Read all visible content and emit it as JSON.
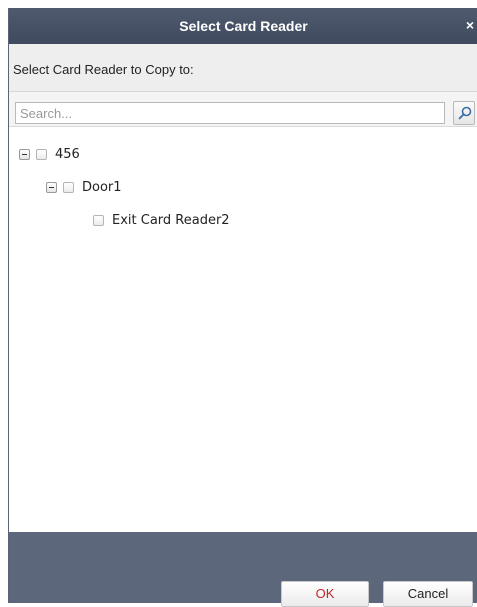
{
  "dialog": {
    "title": "Select Card Reader",
    "close_label": "×",
    "subheader": "Select Card Reader to Copy to:"
  },
  "search": {
    "placeholder": "Search...",
    "icon": "search-icon"
  },
  "tree": {
    "nodes": [
      {
        "label": "456",
        "expanded": true,
        "checked": false,
        "level": 0
      },
      {
        "label": "Door1",
        "expanded": true,
        "checked": false,
        "level": 1
      },
      {
        "label": "Exit Card Reader2",
        "checked": false,
        "level": 2
      }
    ]
  },
  "buttons": {
    "ok_label": "OK",
    "cancel_label": "Cancel"
  },
  "colors": {
    "title_bar": "#4a556a",
    "footer": "#5c677c",
    "ok_text": "#c0262a"
  }
}
